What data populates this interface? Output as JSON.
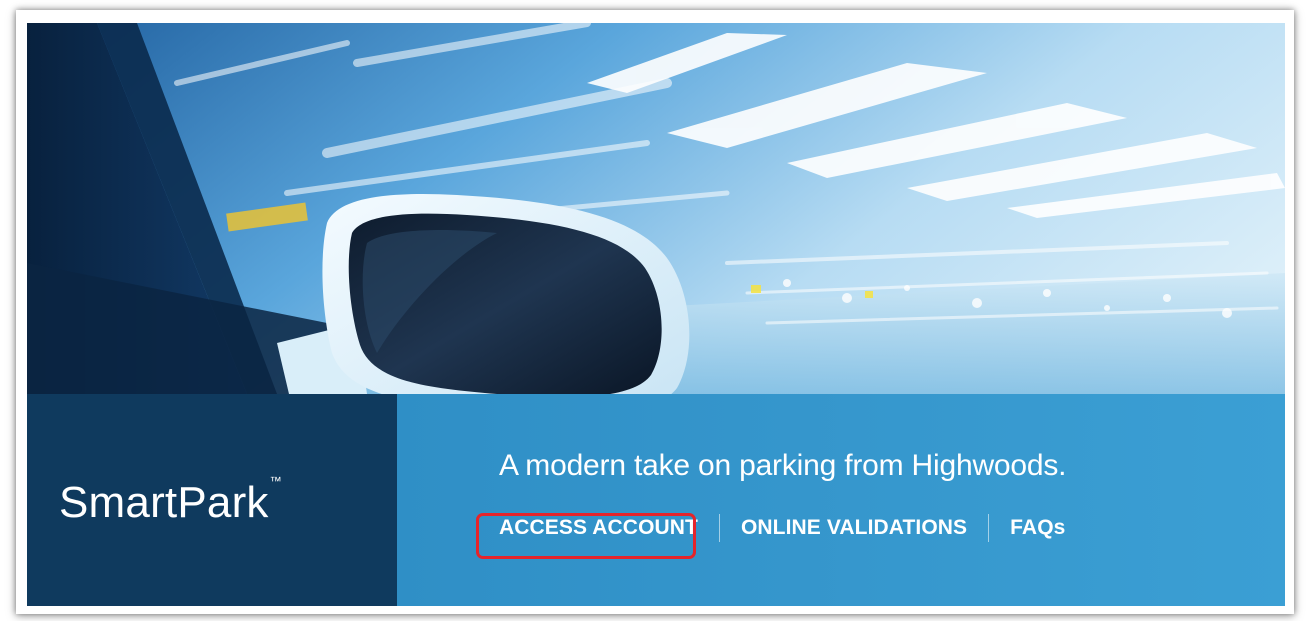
{
  "brand": {
    "name": "SmartPark",
    "trademark": "™"
  },
  "hero": {
    "tagline": "A modern take on parking from Highwoods."
  },
  "nav": {
    "items": [
      {
        "label": "ACCESS ACCOUNT",
        "highlighted": true
      },
      {
        "label": "ONLINE VALIDATIONS",
        "highlighted": false
      },
      {
        "label": "FAQs",
        "highlighted": false
      }
    ]
  },
  "colors": {
    "brand_panel": "#0f3a5e",
    "info_panel": "#3596cc",
    "highlight_border": "#e5242b",
    "text": "#ffffff"
  }
}
